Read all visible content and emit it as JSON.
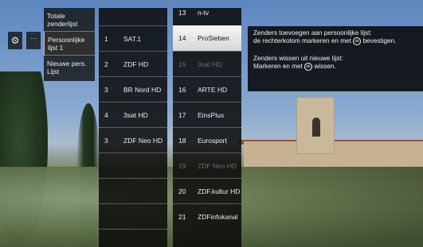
{
  "side_menu": {
    "gear_icon": "gear-icon",
    "more_label": "···",
    "items": [
      {
        "label": "Totale zenderlijst"
      },
      {
        "label": "Persoonlijke lijst 1"
      },
      {
        "label": "Nieuwe pers. Lijst"
      }
    ]
  },
  "left_list": [
    {
      "num": "1",
      "name": "SAT.1"
    },
    {
      "num": "2",
      "name": "ZDF HD"
    },
    {
      "num": "3",
      "name": "BR Nord HD"
    },
    {
      "num": "4",
      "name": "3sat HD"
    },
    {
      "num": "3",
      "name": "ZDF Neo HD"
    },
    {
      "num": "",
      "name": ""
    },
    {
      "num": "",
      "name": ""
    },
    {
      "num": "",
      "name": ""
    },
    {
      "num": "",
      "name": ""
    }
  ],
  "right_list": [
    {
      "num": "13",
      "name": "n-tv"
    },
    {
      "num": "14",
      "name": "ProSieben"
    },
    {
      "num": "15",
      "name": "3sat HD"
    },
    {
      "num": "16",
      "name": "ARTE HD"
    },
    {
      "num": "17",
      "name": "EinsPlus"
    },
    {
      "num": "18",
      "name": "Eurosport"
    },
    {
      "num": "19",
      "name": "ZDF Neo HD"
    },
    {
      "num": "20",
      "name": "ZDF.kultur HD"
    },
    {
      "num": "21",
      "name": "ZDFinfokanal"
    }
  ],
  "info": {
    "line1": "Zenders toevoegen aan persoonlijke lijst:",
    "line2_a": "de rechterkolom markeren en met",
    "line2_b": "bevestigen.",
    "line3": "Zenders wissen uit nieuwe lijst:",
    "line4_a": "Markeren en met",
    "line4_b": "wissen.",
    "ok_icon_label": "ok"
  }
}
